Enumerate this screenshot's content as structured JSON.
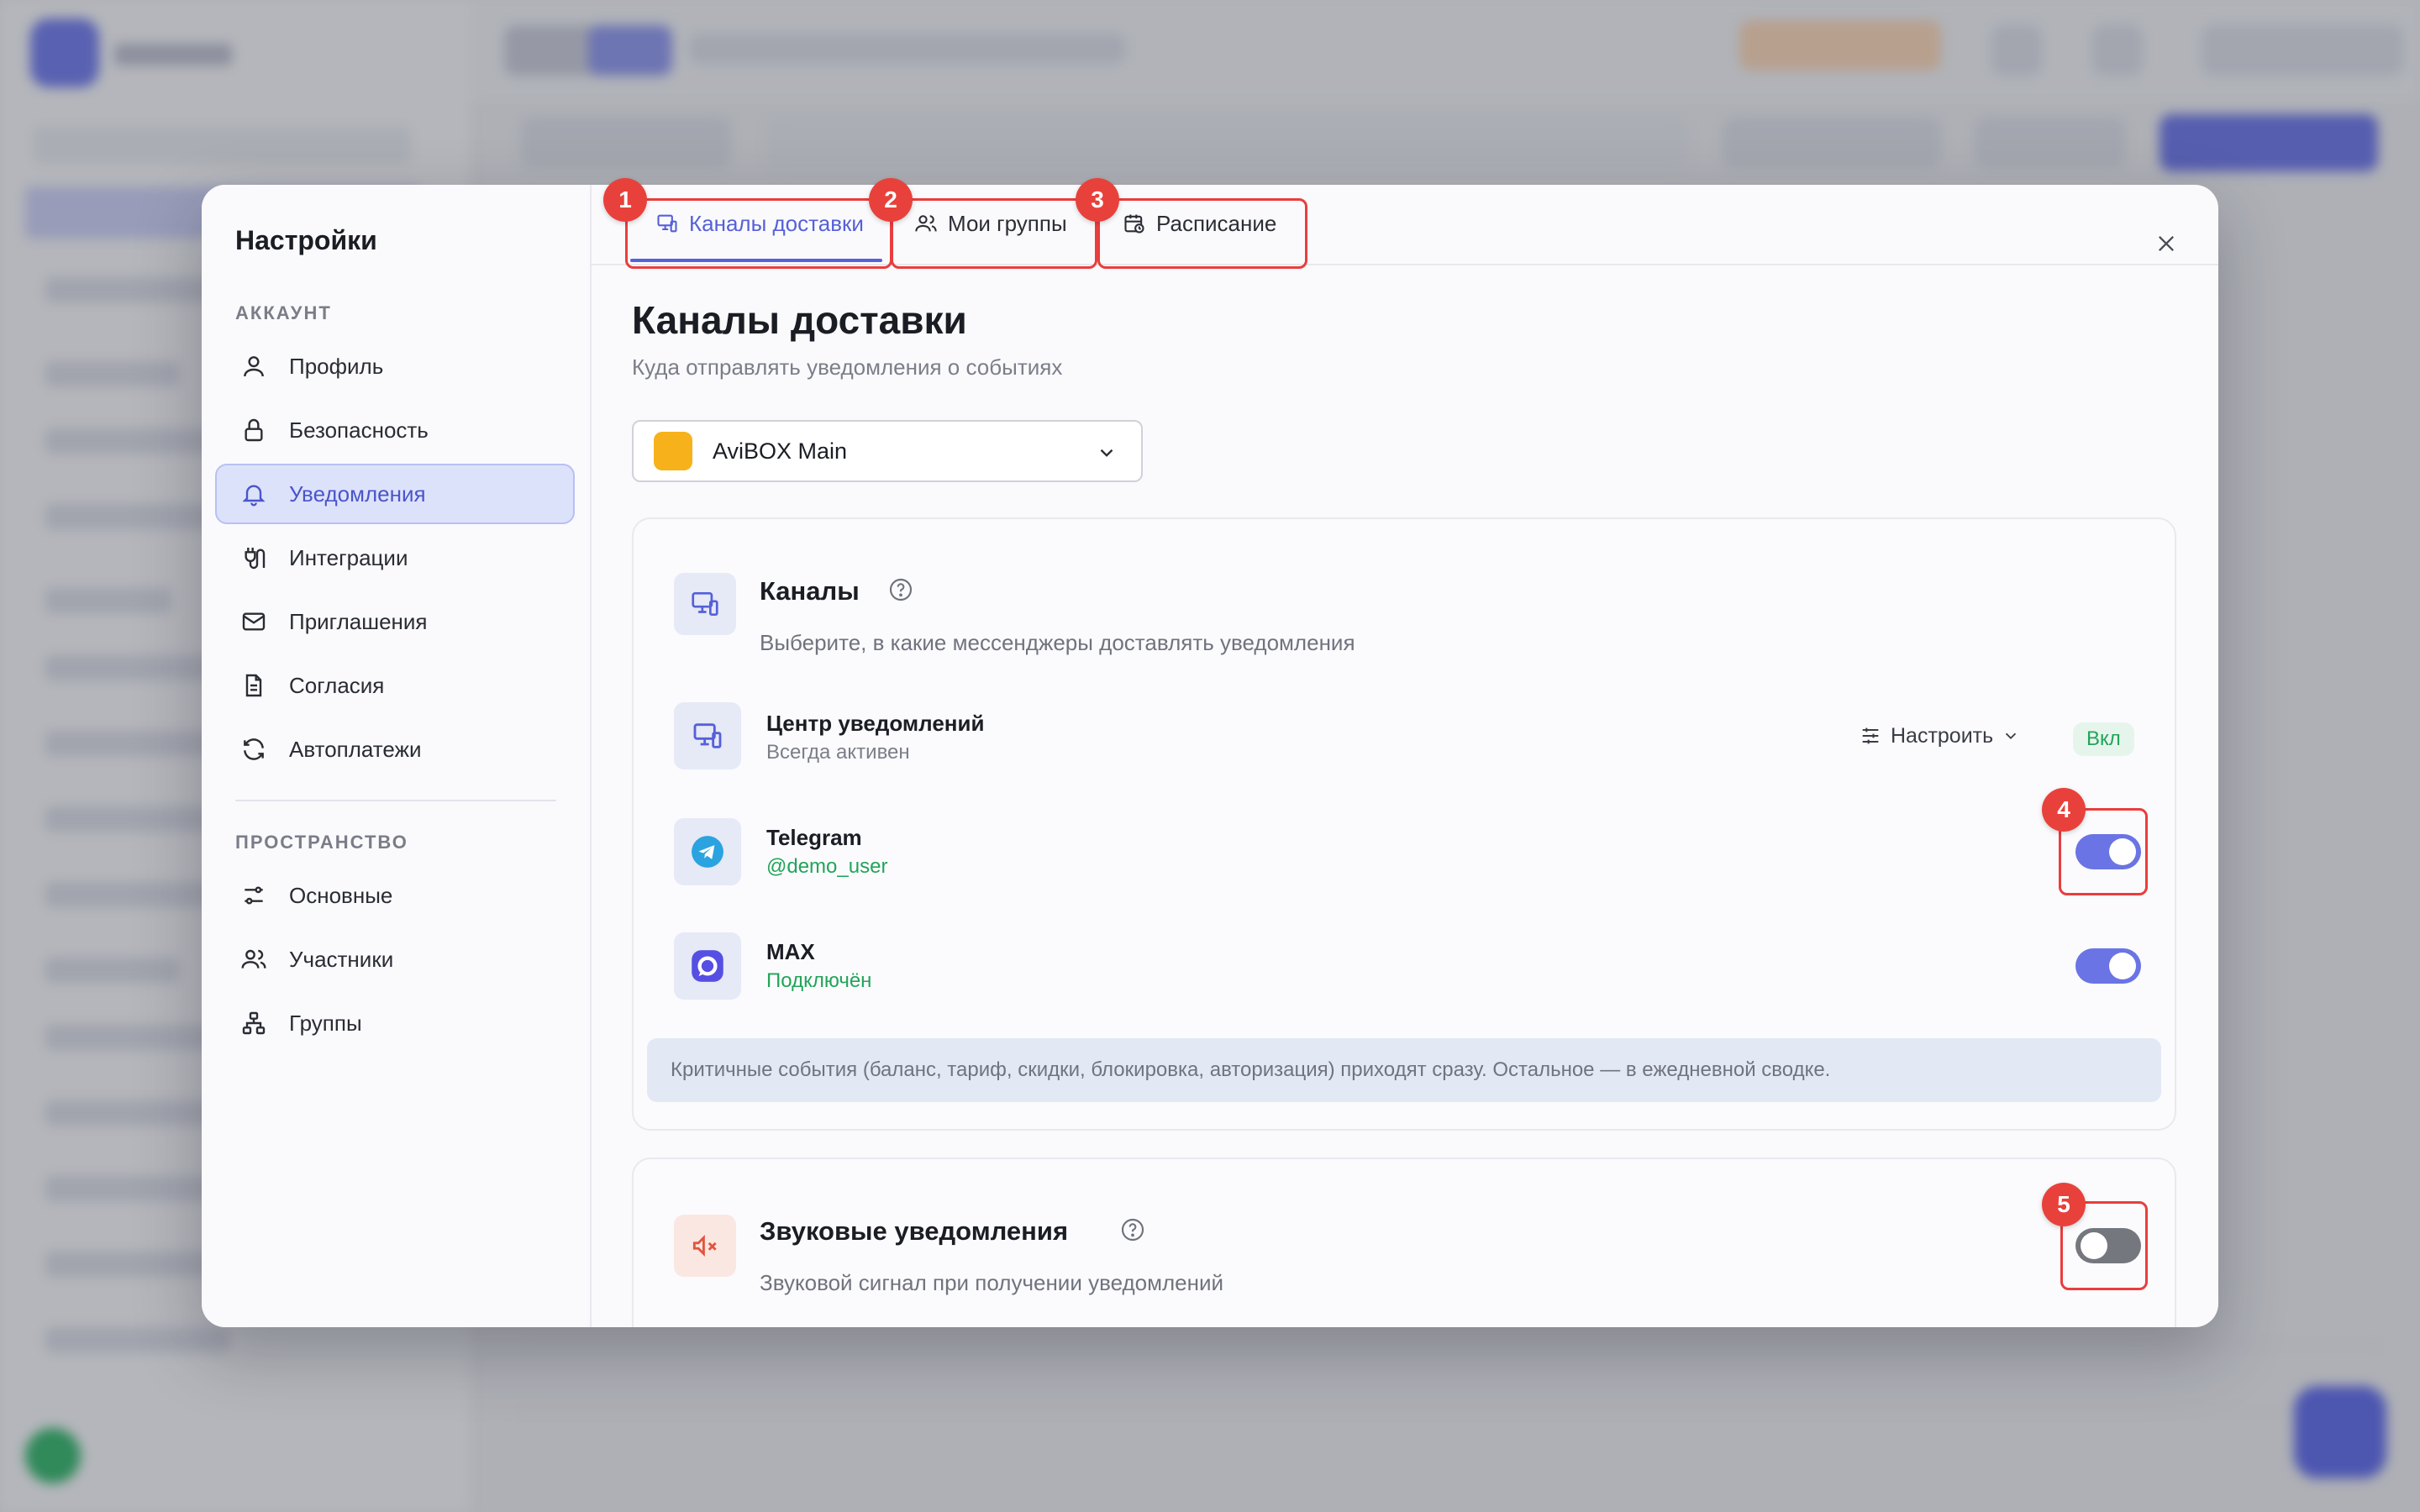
{
  "sidebar": {
    "title": "Настройки",
    "section_account": "АККАУНТ",
    "section_space": "ПРОСТРАНСТВО",
    "items": [
      {
        "label": "Профиль",
        "icon": "user-icon",
        "active": false
      },
      {
        "label": "Безопасность",
        "icon": "lock-icon",
        "active": false
      },
      {
        "label": "Уведомления",
        "icon": "bell-icon",
        "active": true
      },
      {
        "label": "Интеграции",
        "icon": "plug-icon",
        "active": false
      },
      {
        "label": "Приглашения",
        "icon": "mail-icon",
        "active": false
      },
      {
        "label": "Согласия",
        "icon": "document-icon",
        "active": false
      },
      {
        "label": "Автоплатежи",
        "icon": "refresh-icon",
        "active": false
      },
      {
        "label": "Основные",
        "icon": "sliders-icon",
        "active": false
      },
      {
        "label": "Участники",
        "icon": "users-icon",
        "active": false
      },
      {
        "label": "Группы",
        "icon": "hierarchy-icon",
        "active": false
      }
    ]
  },
  "tabs": [
    {
      "label": "Каналы доставки",
      "icon": "devices-icon",
      "active": true
    },
    {
      "label": "Мои группы",
      "icon": "users-icon",
      "active": false
    },
    {
      "label": "Расписание",
      "icon": "calendar-clock-icon",
      "active": false
    }
  ],
  "page": {
    "title": "Каналы доставки",
    "subtitle": "Куда отправлять уведомления о событиях"
  },
  "workspace_select": {
    "value": "AviBOX Main",
    "color": "#f7b21b"
  },
  "channels_card": {
    "title": "Каналы",
    "description": "Выберите, в какие мессенджеры доставлять уведомления",
    "channels": [
      {
        "name": "Центр уведомлений",
        "status": "Всегда активен",
        "status_color": "#7b7e89",
        "configure_label": "Настроить",
        "badge": "Вкл"
      },
      {
        "name": "Telegram",
        "status": "@demo_user",
        "status_color": "#22a45a",
        "enabled": true
      },
      {
        "name": "MAX",
        "status": "Подключён",
        "status_color": "#22a45a",
        "enabled": true
      }
    ],
    "info": "Критичные события (баланс, тариф, скидки, блокировка, авторизация) приходят сразу. Остальное — в ежедневной сводке."
  },
  "sound_card": {
    "title": "Звуковые уведомления",
    "description": "Звуковой сигнал при получении уведомлений",
    "enabled": false
  },
  "annotations": [
    "1",
    "2",
    "3",
    "4",
    "5"
  ],
  "colors": {
    "accent": "#5560d9",
    "toggle_on": "#6a74e4",
    "toggle_off": "#75777f",
    "annotation": "#e8413b",
    "success": "#22a45a"
  }
}
